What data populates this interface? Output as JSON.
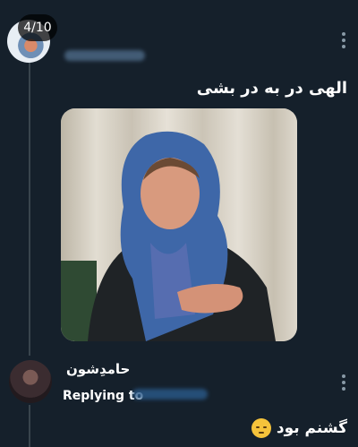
{
  "gallery": {
    "counter": "4/10"
  },
  "tweet1": {
    "text": "الهی در به در بشی",
    "media_description": "image"
  },
  "tweet2": {
    "display_name": "حامدِشون",
    "replying_to_label": "Replying to",
    "text": "گشنم بود",
    "emoji": "pensive-face"
  },
  "colors": {
    "background": "#15202b",
    "thread_line": "#38444d",
    "muted": "#8899a6",
    "link": "#1d9bf0"
  }
}
